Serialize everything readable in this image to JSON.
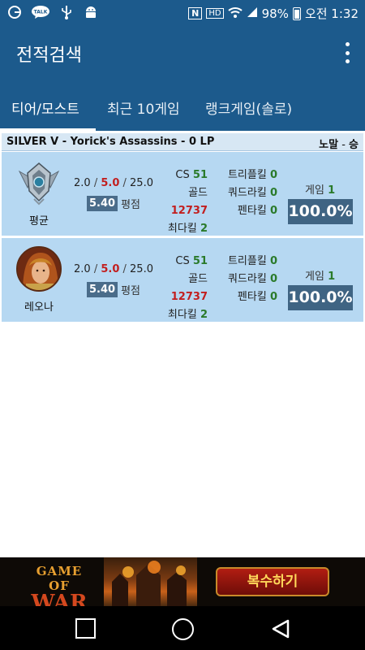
{
  "status_bar": {
    "left_icons": [
      "g-icon",
      "talk-icon",
      "usb-icon",
      "android-icon"
    ],
    "talk_label": "TALK",
    "nfc": "N",
    "hd": "HD",
    "battery": "98%",
    "time": "오전 1:32"
  },
  "app_bar": {
    "title": "전적검색"
  },
  "tabs": [
    {
      "label": "티어/모스트",
      "active": true
    },
    {
      "label": "최근 10게임",
      "active": false
    },
    {
      "label": "랭크게임(솔로)",
      "active": false
    }
  ],
  "header": {
    "tier_info": "SILVER V - Yorick's Assassins - 0 LP",
    "promo_prefix": "노말",
    "promo_sep": " - ",
    "promo_result": "승"
  },
  "rows": [
    {
      "name": "평균",
      "icon": "silver-tier-emblem",
      "kda_k": "2.0",
      "kda_d": "5.0",
      "kda_a": "25.0",
      "sep": " / ",
      "ratio": "5.40",
      "ratio_label": "평점",
      "cs_label": "CS",
      "cs": "51",
      "gold_label": "골드",
      "gold": "12737",
      "max_kill_label": "최다킬",
      "max_kill": "2",
      "triple_label": "트리플킬",
      "triple": "0",
      "quadra_label": "쿼드라킬",
      "quadra": "0",
      "penta_label": "펜타킬",
      "penta": "0",
      "games_label": "게임",
      "games": "1",
      "winrate": "100.0%"
    },
    {
      "name": "레오나",
      "icon": "leona-champion-portrait",
      "kda_k": "2.0",
      "kda_d": "5.0",
      "kda_a": "25.0",
      "sep": " / ",
      "ratio": "5.40",
      "ratio_label": "평점",
      "cs_label": "CS",
      "cs": "51",
      "gold_label": "골드",
      "gold": "12737",
      "max_kill_label": "최다킬",
      "max_kill": "2",
      "triple_label": "트리플킬",
      "triple": "0",
      "quadra_label": "쿼드라킬",
      "quadra": "0",
      "penta_label": "펜타킬",
      "penta": "0",
      "games_label": "게임",
      "games": "1",
      "winrate": "100.0%"
    }
  ],
  "ad": {
    "logo_line1": "GAME OF",
    "logo_line2": "WAR",
    "button": "복수하기"
  },
  "colors": {
    "primary": "#1c5a8c",
    "card": "#b6d8f2",
    "header": "#d7e7f4",
    "winrate_box": "#3f6483",
    "death_red": "#c21f1f",
    "stat_green": "#2a7a2a"
  }
}
